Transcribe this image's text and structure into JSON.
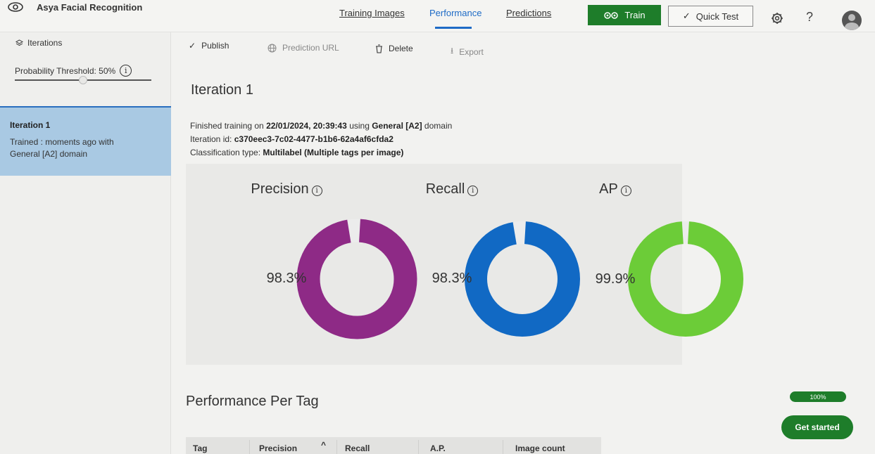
{
  "app": {
    "title": "Asya Facial Recognition"
  },
  "nav": {
    "tabs": [
      {
        "label": "Training Images"
      },
      {
        "label": "Performance"
      },
      {
        "label": "Predictions"
      }
    ],
    "train_label": "Train",
    "quick_test_label": "Quick Test",
    "help_label": "?"
  },
  "sidebar": {
    "iterations_label": "Iterations",
    "threshold_label": "Probability Threshold: 50%",
    "threshold_value": 0.5,
    "iteration_card": {
      "name": "Iteration 1",
      "desc_line1": "Trained : moments ago with",
      "desc_line2": "General [A2] domain"
    }
  },
  "toolbar": {
    "publish": "Publish",
    "prediction_url": "Prediction URL",
    "delete": "Delete",
    "export": "Export"
  },
  "main": {
    "title": "Iteration 1",
    "meta": {
      "trained_prefix": "Finished training on",
      "trained_date": "22/01/2024, 20:39:43",
      "trained_mid": "using",
      "trained_domain": "General [A2]",
      "trained_suffix": "domain",
      "iteration_id_label": "Iteration id:",
      "iteration_id": "c370eec3-7c02-4477-b1b6-62a4af6cfda2",
      "class_type_label": "Classification type:",
      "class_type": "Multilabel (Multiple tags per image)"
    },
    "metrics": [
      {
        "name": "Precision",
        "value_text": "98.3%",
        "value": 98.3,
        "color": "#8e2a86"
      },
      {
        "name": "Recall",
        "value_text": "98.3%",
        "value": 98.3,
        "color": "#1169c4"
      },
      {
        "name": "AP",
        "value_text": "99.9%",
        "value": 99.9,
        "color": "#6ccc38"
      }
    ],
    "per_tag_title": "Performance Per Tag",
    "table_headers": [
      "Tag",
      "Precision",
      "Recall",
      "A.P.",
      "Image count"
    ]
  },
  "progress_badge": "100%",
  "get_started_label": "Get started"
}
